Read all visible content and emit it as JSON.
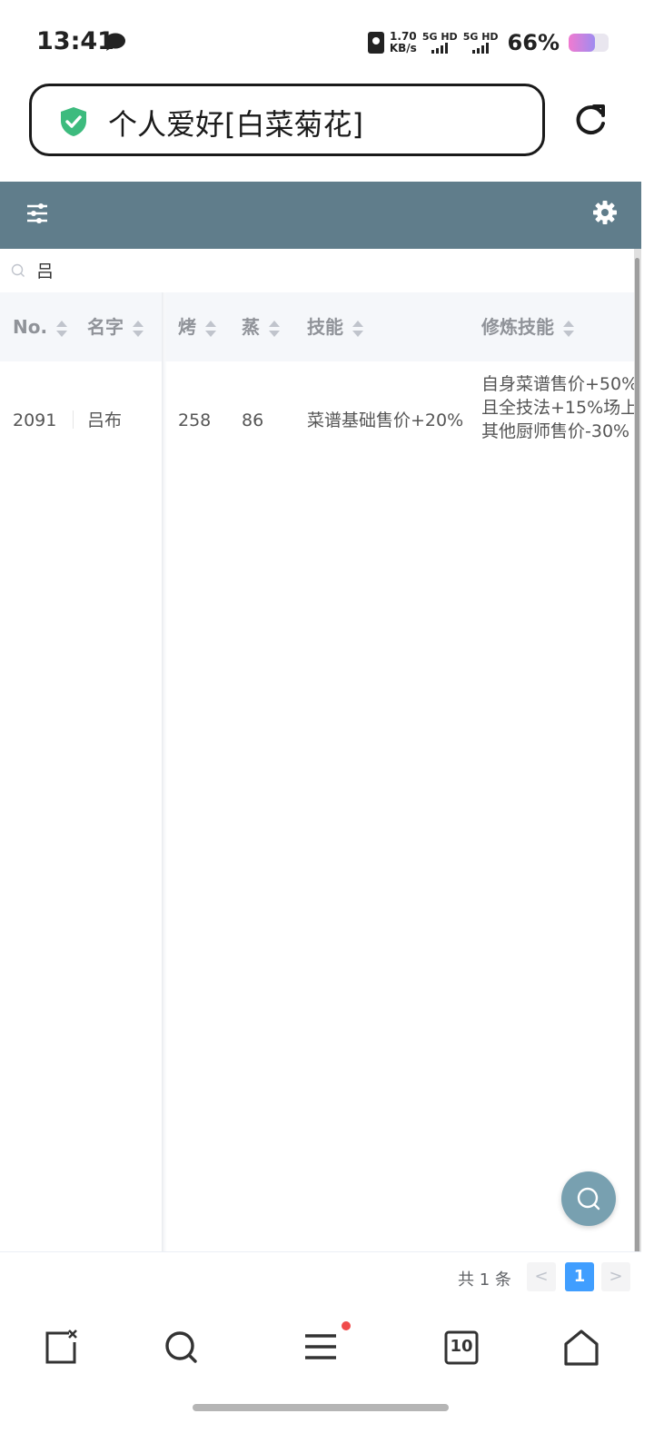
{
  "status_bar": {
    "time": "13:41",
    "speed_value": "1.70",
    "speed_unit": "KB/s",
    "net1": "5G HD",
    "net2": "5G HD",
    "battery_percent": "66%",
    "battery_level": 0.66
  },
  "browser": {
    "page_title": "个人爱好[白菜菊花]"
  },
  "search": {
    "value": "吕"
  },
  "table": {
    "columns": [
      "No.",
      "名字",
      "烤",
      "蒸",
      "技能",
      "修炼技能"
    ],
    "rows": [
      {
        "no": "2091",
        "name": "吕布",
        "roast": "258",
        "steam": "86",
        "skill": "菜谱基础售价+20%",
        "trained_skill": "自身菜谱售价+50%且全技法+15%场上其他厨师售价-30%"
      }
    ]
  },
  "pagination": {
    "total_label": "共 1 条",
    "current_page": "1",
    "prev": "<",
    "next": ">"
  },
  "bottom_nav": {
    "tabs_count": "10"
  },
  "colors": {
    "toolbar": "#607d8b",
    "accent": "#409eff",
    "shield": "#3dbb7e",
    "fab": "#78a0b0"
  }
}
